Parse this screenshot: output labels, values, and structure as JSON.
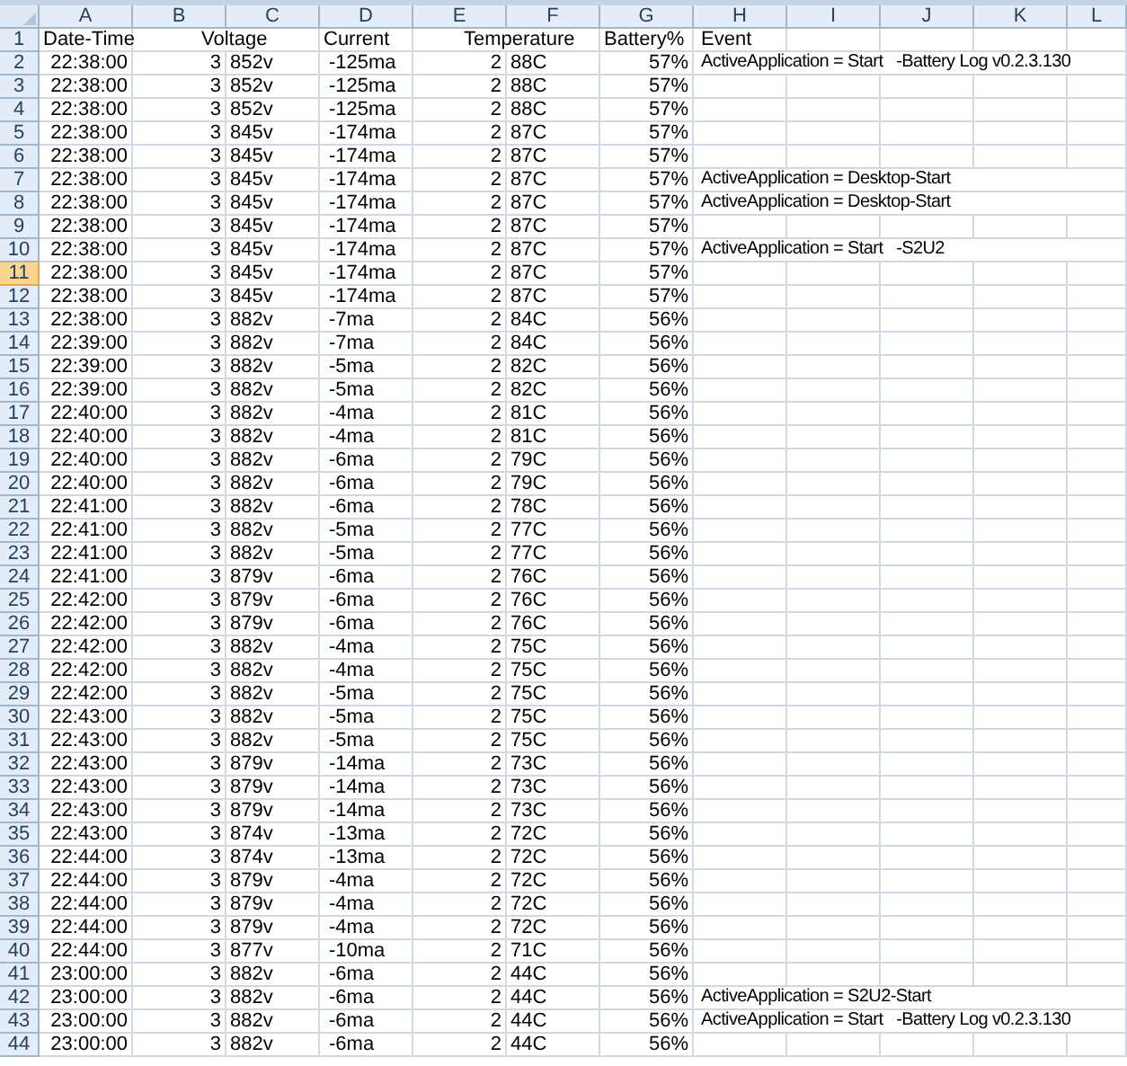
{
  "columns": [
    "A",
    "B",
    "C",
    "D",
    "E",
    "F",
    "G",
    "H",
    "I",
    "J",
    "K",
    "L"
  ],
  "header_row": {
    "number": "1",
    "labels": {
      "time": "Date-Time",
      "voltage": "Voltage",
      "current": "Current",
      "temperature": "Temperature",
      "battery": "Battery%",
      "event": "Event"
    }
  },
  "rows": [
    {
      "number": "2",
      "selected": false,
      "time": "22:38:00",
      "voltage_whole": "3",
      "voltage_rest": "852v",
      "current": "-125ma",
      "temperature_whole": "2",
      "temperature_rest": "88C",
      "battery": "57%",
      "event": "ActiveApplication = Start   -Battery Log v0.2.3.130"
    },
    {
      "number": "3",
      "selected": false,
      "time": "22:38:00",
      "voltage_whole": "3",
      "voltage_rest": "852v",
      "current": "-125ma",
      "temperature_whole": "2",
      "temperature_rest": "88C",
      "battery": "57%"
    },
    {
      "number": "4",
      "selected": false,
      "time": "22:38:00",
      "voltage_whole": "3",
      "voltage_rest": "852v",
      "current": "-125ma",
      "temperature_whole": "2",
      "temperature_rest": "88C",
      "battery": "57%"
    },
    {
      "number": "5",
      "selected": false,
      "time": "22:38:00",
      "voltage_whole": "3",
      "voltage_rest": "845v",
      "current": "-174ma",
      "temperature_whole": "2",
      "temperature_rest": "87C",
      "battery": "57%"
    },
    {
      "number": "6",
      "selected": false,
      "time": "22:38:00",
      "voltage_whole": "3",
      "voltage_rest": "845v",
      "current": "-174ma",
      "temperature_whole": "2",
      "temperature_rest": "87C",
      "battery": "57%"
    },
    {
      "number": "7",
      "selected": false,
      "time": "22:38:00",
      "voltage_whole": "3",
      "voltage_rest": "845v",
      "current": "-174ma",
      "temperature_whole": "2",
      "temperature_rest": "87C",
      "battery": "57%",
      "event": "ActiveApplication = Desktop-Start"
    },
    {
      "number": "8",
      "selected": false,
      "time": "22:38:00",
      "voltage_whole": "3",
      "voltage_rest": "845v",
      "current": "-174ma",
      "temperature_whole": "2",
      "temperature_rest": "87C",
      "battery": "57%",
      "event": "ActiveApplication = Desktop-Start"
    },
    {
      "number": "9",
      "selected": false,
      "time": "22:38:00",
      "voltage_whole": "3",
      "voltage_rest": "845v",
      "current": "-174ma",
      "temperature_whole": "2",
      "temperature_rest": "87C",
      "battery": "57%"
    },
    {
      "number": "10",
      "selected": false,
      "time": "22:38:00",
      "voltage_whole": "3",
      "voltage_rest": "845v",
      "current": "-174ma",
      "temperature_whole": "2",
      "temperature_rest": "87C",
      "battery": "57%",
      "event": "ActiveApplication = Start   -S2U2"
    },
    {
      "number": "11",
      "selected": true,
      "time": "22:38:00",
      "voltage_whole": "3",
      "voltage_rest": "845v",
      "current": "-174ma",
      "temperature_whole": "2",
      "temperature_rest": "87C",
      "battery": "57%"
    },
    {
      "number": "12",
      "selected": false,
      "time": "22:38:00",
      "voltage_whole": "3",
      "voltage_rest": "845v",
      "current": "-174ma",
      "temperature_whole": "2",
      "temperature_rest": "87C",
      "battery": "57%"
    },
    {
      "number": "13",
      "selected": false,
      "time": "22:38:00",
      "voltage_whole": "3",
      "voltage_rest": "882v",
      "current": "-7ma",
      "temperature_whole": "2",
      "temperature_rest": "84C",
      "battery": "56%"
    },
    {
      "number": "14",
      "selected": false,
      "time": "22:39:00",
      "voltage_whole": "3",
      "voltage_rest": "882v",
      "current": "-7ma",
      "temperature_whole": "2",
      "temperature_rest": "84C",
      "battery": "56%"
    },
    {
      "number": "15",
      "selected": false,
      "time": "22:39:00",
      "voltage_whole": "3",
      "voltage_rest": "882v",
      "current": "-5ma",
      "temperature_whole": "2",
      "temperature_rest": "82C",
      "battery": "56%"
    },
    {
      "number": "16",
      "selected": false,
      "time": "22:39:00",
      "voltage_whole": "3",
      "voltage_rest": "882v",
      "current": "-5ma",
      "temperature_whole": "2",
      "temperature_rest": "82C",
      "battery": "56%"
    },
    {
      "number": "17",
      "selected": false,
      "time": "22:40:00",
      "voltage_whole": "3",
      "voltage_rest": "882v",
      "current": "-4ma",
      "temperature_whole": "2",
      "temperature_rest": "81C",
      "battery": "56%"
    },
    {
      "number": "18",
      "selected": false,
      "time": "22:40:00",
      "voltage_whole": "3",
      "voltage_rest": "882v",
      "current": "-4ma",
      "temperature_whole": "2",
      "temperature_rest": "81C",
      "battery": "56%"
    },
    {
      "number": "19",
      "selected": false,
      "time": "22:40:00",
      "voltage_whole": "3",
      "voltage_rest": "882v",
      "current": "-6ma",
      "temperature_whole": "2",
      "temperature_rest": "79C",
      "battery": "56%"
    },
    {
      "number": "20",
      "selected": false,
      "time": "22:40:00",
      "voltage_whole": "3",
      "voltage_rest": "882v",
      "current": "-6ma",
      "temperature_whole": "2",
      "temperature_rest": "79C",
      "battery": "56%"
    },
    {
      "number": "21",
      "selected": false,
      "time": "22:41:00",
      "voltage_whole": "3",
      "voltage_rest": "882v",
      "current": "-6ma",
      "temperature_whole": "2",
      "temperature_rest": "78C",
      "battery": "56%"
    },
    {
      "number": "22",
      "selected": false,
      "time": "22:41:00",
      "voltage_whole": "3",
      "voltage_rest": "882v",
      "current": "-5ma",
      "temperature_whole": "2",
      "temperature_rest": "77C",
      "battery": "56%"
    },
    {
      "number": "23",
      "selected": false,
      "time": "22:41:00",
      "voltage_whole": "3",
      "voltage_rest": "882v",
      "current": "-5ma",
      "temperature_whole": "2",
      "temperature_rest": "77C",
      "battery": "56%"
    },
    {
      "number": "24",
      "selected": false,
      "time": "22:41:00",
      "voltage_whole": "3",
      "voltage_rest": "879v",
      "current": "-6ma",
      "temperature_whole": "2",
      "temperature_rest": "76C",
      "battery": "56%"
    },
    {
      "number": "25",
      "selected": false,
      "time": "22:42:00",
      "voltage_whole": "3",
      "voltage_rest": "879v",
      "current": "-6ma",
      "temperature_whole": "2",
      "temperature_rest": "76C",
      "battery": "56%"
    },
    {
      "number": "26",
      "selected": false,
      "time": "22:42:00",
      "voltage_whole": "3",
      "voltage_rest": "879v",
      "current": "-6ma",
      "temperature_whole": "2",
      "temperature_rest": "76C",
      "battery": "56%"
    },
    {
      "number": "27",
      "selected": false,
      "time": "22:42:00",
      "voltage_whole": "3",
      "voltage_rest": "882v",
      "current": "-4ma",
      "temperature_whole": "2",
      "temperature_rest": "75C",
      "battery": "56%"
    },
    {
      "number": "28",
      "selected": false,
      "time": "22:42:00",
      "voltage_whole": "3",
      "voltage_rest": "882v",
      "current": "-4ma",
      "temperature_whole": "2",
      "temperature_rest": "75C",
      "battery": "56%"
    },
    {
      "number": "29",
      "selected": false,
      "time": "22:42:00",
      "voltage_whole": "3",
      "voltage_rest": "882v",
      "current": "-5ma",
      "temperature_whole": "2",
      "temperature_rest": "75C",
      "battery": "56%"
    },
    {
      "number": "30",
      "selected": false,
      "time": "22:43:00",
      "voltage_whole": "3",
      "voltage_rest": "882v",
      "current": "-5ma",
      "temperature_whole": "2",
      "temperature_rest": "75C",
      "battery": "56%"
    },
    {
      "number": "31",
      "selected": false,
      "time": "22:43:00",
      "voltage_whole": "3",
      "voltage_rest": "882v",
      "current": "-5ma",
      "temperature_whole": "2",
      "temperature_rest": "75C",
      "battery": "56%"
    },
    {
      "number": "32",
      "selected": false,
      "time": "22:43:00",
      "voltage_whole": "3",
      "voltage_rest": "879v",
      "current": "-14ma",
      "temperature_whole": "2",
      "temperature_rest": "73C",
      "battery": "56%"
    },
    {
      "number": "33",
      "selected": false,
      "time": "22:43:00",
      "voltage_whole": "3",
      "voltage_rest": "879v",
      "current": "-14ma",
      "temperature_whole": "2",
      "temperature_rest": "73C",
      "battery": "56%"
    },
    {
      "number": "34",
      "selected": false,
      "time": "22:43:00",
      "voltage_whole": "3",
      "voltage_rest": "879v",
      "current": "-14ma",
      "temperature_whole": "2",
      "temperature_rest": "73C",
      "battery": "56%"
    },
    {
      "number": "35",
      "selected": false,
      "time": "22:43:00",
      "voltage_whole": "3",
      "voltage_rest": "874v",
      "current": "-13ma",
      "temperature_whole": "2",
      "temperature_rest": "72C",
      "battery": "56%"
    },
    {
      "number": "36",
      "selected": false,
      "time": "22:44:00",
      "voltage_whole": "3",
      "voltage_rest": "874v",
      "current": "-13ma",
      "temperature_whole": "2",
      "temperature_rest": "72C",
      "battery": "56%"
    },
    {
      "number": "37",
      "selected": false,
      "time": "22:44:00",
      "voltage_whole": "3",
      "voltage_rest": "879v",
      "current": "-4ma",
      "temperature_whole": "2",
      "temperature_rest": "72C",
      "battery": "56%"
    },
    {
      "number": "38",
      "selected": false,
      "time": "22:44:00",
      "voltage_whole": "3",
      "voltage_rest": "879v",
      "current": "-4ma",
      "temperature_whole": "2",
      "temperature_rest": "72C",
      "battery": "56%"
    },
    {
      "number": "39",
      "selected": false,
      "time": "22:44:00",
      "voltage_whole": "3",
      "voltage_rest": "879v",
      "current": "-4ma",
      "temperature_whole": "2",
      "temperature_rest": "72C",
      "battery": "56%"
    },
    {
      "number": "40",
      "selected": false,
      "time": "22:44:00",
      "voltage_whole": "3",
      "voltage_rest": "877v",
      "current": "-10ma",
      "temperature_whole": "2",
      "temperature_rest": "71C",
      "battery": "56%"
    },
    {
      "number": "41",
      "selected": false,
      "time": "23:00:00",
      "voltage_whole": "3",
      "voltage_rest": "882v",
      "current": "-6ma",
      "temperature_whole": "2",
      "temperature_rest": "44C",
      "battery": "56%"
    },
    {
      "number": "42",
      "selected": false,
      "time": "23:00:00",
      "voltage_whole": "3",
      "voltage_rest": "882v",
      "current": "-6ma",
      "temperature_whole": "2",
      "temperature_rest": "44C",
      "battery": "56%",
      "event": "ActiveApplication = S2U2-Start"
    },
    {
      "number": "43",
      "selected": false,
      "time": "23:00:00",
      "voltage_whole": "3",
      "voltage_rest": "882v",
      "current": "-6ma",
      "temperature_whole": "2",
      "temperature_rest": "44C",
      "battery": "56%",
      "event": "ActiveApplication = Start   -Battery Log v0.2.3.130"
    },
    {
      "number": "44",
      "selected": false,
      "time": "23:00:00",
      "voltage_whole": "3",
      "voltage_rest": "882v",
      "current": "-6ma",
      "temperature_whole": "2",
      "temperature_rest": "44C",
      "battery": "56%"
    }
  ]
}
